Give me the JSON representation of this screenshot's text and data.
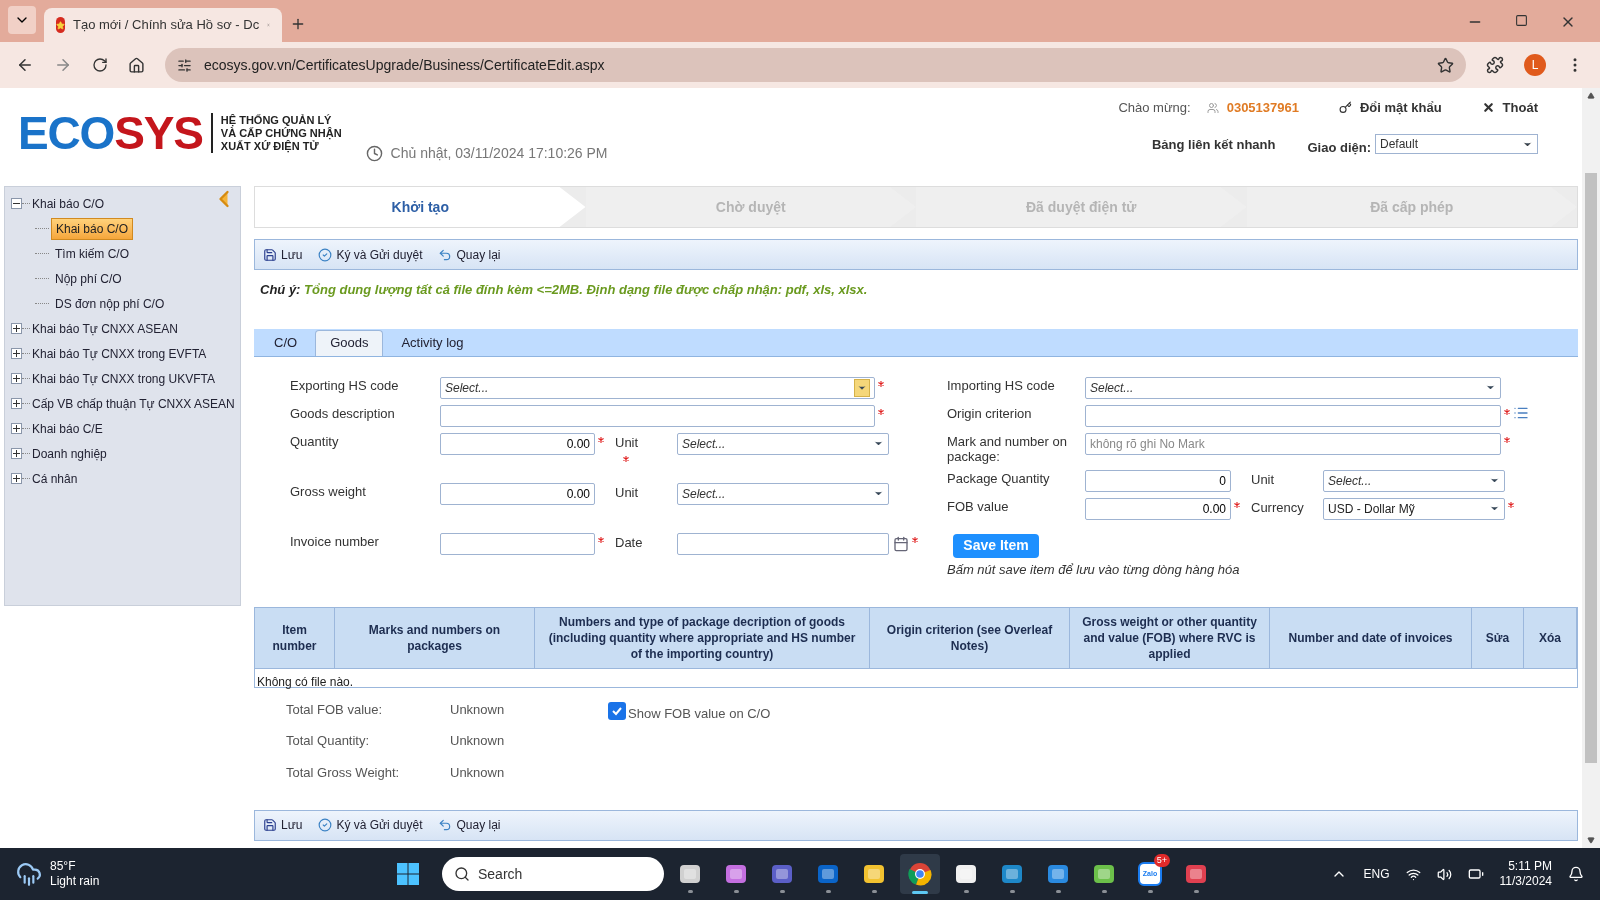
{
  "browser": {
    "tabs": [
      {
        "title": "Tạo mới / Chính sửa Hồ sơ - Dc",
        "selected": true
      }
    ],
    "url": "ecosys.gov.vn/CertificatesUpgrade/Business/CertificateEdit.aspx",
    "profile_initial": "L"
  },
  "header": {
    "logo": {
      "part_1": "ECO",
      "part_2": "SYS",
      "tagline": [
        "HỆ THỐNG QUẢN LÝ",
        "VÀ CẤP CHỨNG NHẬN",
        "XUẤT XỨ ĐIỆN TỬ"
      ]
    },
    "datetime": "Chủ nhật, 03/11/2024 17:10:26 PM",
    "greeting": "Chào mừng:",
    "user": "0305137961",
    "change_password": "Đổi mật khẩu",
    "logout": "Thoát",
    "quick_links": "Bảng liên kết nhanh",
    "theme": {
      "label": "Giao diện:",
      "value": "Default"
    }
  },
  "sidebar": {
    "tree": [
      {
        "label": "Khai báo C/O",
        "expanded": true,
        "children": [
          {
            "label": "Khai báo C/O",
            "selected": true
          },
          {
            "label": "Tìm kiếm C/O",
            "selected": false
          },
          {
            "label": "Nộp phí C/O",
            "selected": false
          },
          {
            "label": "DS đơn nộp phí C/O",
            "selected": false
          }
        ]
      },
      {
        "label": "Khai báo Tự CNXX ASEAN",
        "expanded": false
      },
      {
        "label": "Khai báo Tự CNXX trong EVFTA",
        "expanded": false
      },
      {
        "label": "Khai báo Tự CNXX trong UKVFTA",
        "expanded": false
      },
      {
        "label": "Cấp VB chấp thuận Tự CNXX ASEAN",
        "expanded": false
      },
      {
        "label": "Khai báo C/E",
        "expanded": false
      },
      {
        "label": "Doanh nghiệp",
        "expanded": false
      },
      {
        "label": "Cá nhân",
        "expanded": false
      }
    ]
  },
  "steps": [
    {
      "label": "Khởi tạo",
      "selected": true
    },
    {
      "label": "Chờ duyệt",
      "selected": false
    },
    {
      "label": "Đã duyệt điện tử",
      "selected": false
    },
    {
      "label": "Đã cấp phép",
      "selected": false
    }
  ],
  "toolbar_top": [
    {
      "kind": "save",
      "label": "Lưu"
    },
    {
      "kind": "sign",
      "label": "Ký và Gửi duyệt"
    },
    {
      "kind": "back",
      "label": "Quay lại"
    }
  ],
  "toolbar_bottom": [
    {
      "kind": "save",
      "label": "Lưu"
    },
    {
      "kind": "sign",
      "label": "Ký và Gửi duyệt"
    },
    {
      "kind": "back",
      "label": "Quay lại"
    }
  ],
  "note": {
    "label": "Chú ý:",
    "text": "Tổng dung lượng tất cả file đính kèm <=2MB. Định dạng file được chấp nhận: pdf, xls, xlsx."
  },
  "tabs": [
    {
      "label": "C/O",
      "selected": false
    },
    {
      "label": "Goods",
      "selected": true
    },
    {
      "label": "Activity log",
      "selected": false
    }
  ],
  "form": {
    "left": [
      {
        "main": {
          "label": "Exporting HS code",
          "kind": "combo",
          "placeholder": "Select...",
          "required": true
        }
      },
      {
        "main": {
          "label": "Goods description",
          "kind": "text",
          "required": true
        }
      },
      {
        "main": {
          "label": "Quantity",
          "kind": "number",
          "value": "0.00",
          "required": true
        },
        "side": {
          "label": "Unit",
          "kind": "select",
          "placeholder": "Select...",
          "required": true
        }
      },
      {
        "main": {
          "label": "Gross weight",
          "kind": "number",
          "value": "0.00",
          "required": false
        },
        "side": {
          "label": "Unit",
          "kind": "select",
          "placeholder": "Select...",
          "required": false
        }
      },
      {
        "main": {
          "label": "Invoice number",
          "kind": "text",
          "required": true
        },
        "side": {
          "label": "Date",
          "kind": "date",
          "required": true
        }
      }
    ],
    "right": [
      {
        "main": {
          "label": "Importing HS code",
          "kind": "select",
          "placeholder": "Select...",
          "required": false
        }
      },
      {
        "main": {
          "label": "Origin criterion",
          "kind": "text",
          "required": true,
          "list_button": true
        }
      },
      {
        "main": {
          "label": "Mark and number on package:",
          "kind": "text",
          "placeholder": "không rõ ghi No Mark",
          "required": true
        }
      },
      {
        "main": {
          "label": "Package Quantity",
          "kind": "number",
          "value": "0",
          "required": false
        },
        "side": {
          "label": "Unit",
          "kind": "select",
          "placeholder": "Select...",
          "required": false
        }
      },
      {
        "main": {
          "label": "FOB value",
          "kind": "number",
          "value": "0.00",
          "required": true
        },
        "side": {
          "label": "Currency",
          "kind": "select",
          "value": "USD - Dollar Mỹ",
          "required": true
        }
      }
    ],
    "save_button": "Save Item",
    "hint": "Bấm nút save item để lưu vào từng dòng hàng hóa"
  },
  "table": {
    "columns": [
      "Item number",
      "Marks and numbers on packages",
      "Numbers and type of package decription of goods (including quantity where appropriate and HS number of the importing country)",
      "Origin criterion (see Overleaf Notes)",
      "Gross weight or other quantity and value (FOB) where RVC is applied",
      "Number and date of invoices",
      "Sửa",
      "Xóa"
    ],
    "empty_text": "Không có file nào."
  },
  "totals": [
    {
      "label": "Total FOB value:",
      "value": "Unknown"
    },
    {
      "label": "Total Quantity:",
      "value": "Unknown"
    },
    {
      "label": "Total Gross Weight:",
      "value": "Unknown"
    }
  ],
  "show_fob": {
    "label": "Show FOB value on C/O",
    "checked": true
  },
  "taskbar": {
    "weather": {
      "temp": "85°F",
      "text": "Light rain"
    },
    "search": "Search",
    "apps": [
      {
        "kind": "taskview",
        "selected": false
      },
      {
        "kind": "copilot",
        "selected": false
      },
      {
        "kind": "teams",
        "selected": false
      },
      {
        "kind": "outlook",
        "selected": false
      },
      {
        "kind": "files",
        "selected": false
      },
      {
        "kind": "chrome",
        "selected": true
      },
      {
        "kind": "store",
        "selected": false
      },
      {
        "kind": "edge",
        "selected": false
      },
      {
        "kind": "search2",
        "selected": false
      },
      {
        "kind": "green",
        "selected": false
      },
      {
        "kind": "zalo",
        "selected": false,
        "label": "Zalo",
        "badge": "5+"
      },
      {
        "kind": "snip",
        "selected": false
      }
    ],
    "language": "ENG",
    "time": "5:11 PM",
    "date": "11/3/2024"
  }
}
